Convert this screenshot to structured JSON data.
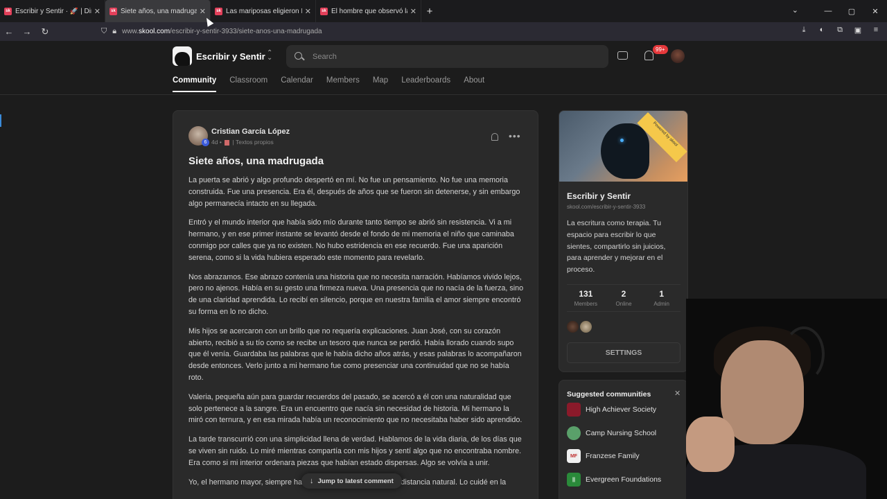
{
  "browser": {
    "tabs": [
      {
        "title": "Escribir y Sentir · 🚀 | Dinámica",
        "fav": "sk",
        "active": false
      },
      {
        "title": "Siete años, una madrugada · E",
        "fav": "sk",
        "active": true
      },
      {
        "title": "Las mariposas eligieron IV · Esc",
        "fav": "sk",
        "active": false
      },
      {
        "title": "El hombre que observó la luz I ·",
        "fav": "sk",
        "active": false
      }
    ],
    "url_prefix": "www.",
    "url_domain": "skool.com",
    "url_path": "/escribir-y-sentir-3933/siete-anos-una-madrugada"
  },
  "header": {
    "community_name": "Escribir y Sentir",
    "search_placeholder": "Search",
    "notification_count": "99+"
  },
  "nav_tabs": [
    "Community",
    "Classroom",
    "Calendar",
    "Members",
    "Map",
    "Leaderboards",
    "About"
  ],
  "post": {
    "author": "Cristian García López",
    "level": "6",
    "time": "4d",
    "category": "| Textos propios",
    "title": "Siete años, una madrugada",
    "paragraphs": [
      "La puerta se abrió y algo profundo despertó en mí. No fue un pensamiento. No fue una memoria construida. Fue una presencia. Era él, después de años que se fueron sin detenerse, y sin embargo algo permanecía intacto en su llegada.",
      "Entró y el mundo interior que había sido mío durante tanto tiempo se abrió sin resistencia. Vi a mi hermano, y en ese primer instante se levantó desde el fondo de mi memoria el niño que caminaba conmigo por calles que ya no existen. No hubo estridencia en ese recuerdo. Fue una aparición serena, como si la vida hubiera esperado este momento para revelarlo.",
      "Nos abrazamos. Ese abrazo contenía una historia que no necesita narración. Habíamos vivido lejos, pero no ajenos. Había en su gesto una firmeza nueva. Una presencia que no nacía de la fuerza, sino de una claridad aprendida. Lo recibí en silencio, porque en nuestra familia el amor siempre encontró su forma en lo no dicho.",
      "Mis hijos se acercaron con un brillo que no requería explicaciones. Juan José, con su corazón abierto, recibió a su tío como se recibe un tesoro que nunca se perdió. Había llorado cuando supo que él venía. Guardaba las palabras que le había dicho años atrás, y esas palabras lo acompañaron desde entonces. Verlo junto a mi hermano fue como presenciar una continuidad que no se había roto.",
      "Valeria, pequeña aún para guardar recuerdos del pasado, se acercó a él con una naturalidad que solo pertenece a la sangre. Era un encuentro que nacía sin necesidad de historia. Mi hermano la miró con ternura, y en esa mirada había un reconocimiento que no necesitaba haber sido aprendido.",
      "La tarde transcurrió con una simplicidad llena de verdad. Hablamos de la vida diaria, de los días que se viven sin ruido. Lo miré mientras compartía con mis hijos y sentí algo que no encontraba nombre. Era como si mi interior ordenara piezas que habían estado dispersas. Algo se volvía a unir.",
      "Yo, el hermano mayor, siempre había pensado en él desde una distancia natural. Lo cuidé en la"
    ],
    "jump_label": "Jump to latest comment"
  },
  "sidebar": {
    "name": "Escribir y Sentir",
    "url": "skool.com/escribir-y-sentir-3933",
    "description": "La escritura como terapia. Tu espacio para escribir lo que sientes, compartirlo sin juicios, para aprender y mejorar en el proceso.",
    "stats": [
      {
        "n": "131",
        "l": "Members"
      },
      {
        "n": "2",
        "l": "Online"
      },
      {
        "n": "1",
        "l": "Admin"
      }
    ],
    "settings_label": "SETTINGS",
    "ribbon": "Powered by skool"
  },
  "suggested": {
    "title": "Suggested communities",
    "items": [
      {
        "name": "High Achiever Society",
        "color": "#8a1a2a",
        "ico": ""
      },
      {
        "name": "Camp Nursing School",
        "color": "#5aa06a",
        "ico": ""
      },
      {
        "name": "Franzese Family",
        "color": "#f0f0f0",
        "ico": "MF"
      },
      {
        "name": "Evergreen Foundations",
        "color": "#2a8a3a",
        "ico": "||"
      }
    ]
  }
}
